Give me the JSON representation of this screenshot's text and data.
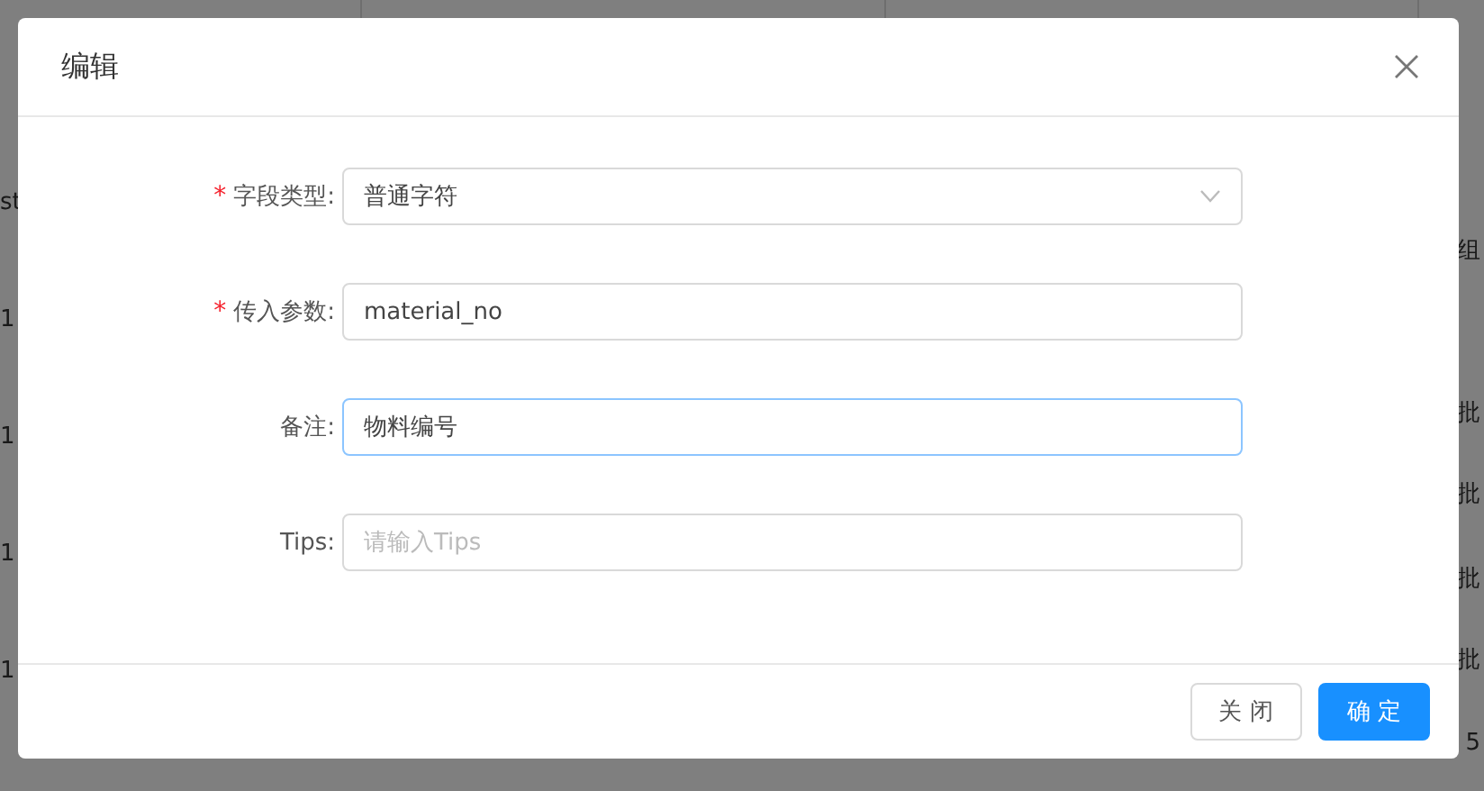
{
  "background_table": {
    "left_cells": [
      "st",
      "1",
      "1",
      "1",
      "1"
    ],
    "right_cells": [
      "组",
      "批",
      "批",
      "批",
      "批",
      "5"
    ]
  },
  "dialog": {
    "title": "编辑",
    "fields": [
      {
        "kind": "select",
        "label": "字段类型:",
        "required_mark": "*",
        "value": "普通字符",
        "focused": false
      },
      {
        "kind": "input",
        "label": "传入参数:",
        "required_mark": "*",
        "value": "material_no",
        "focused": false
      },
      {
        "kind": "input",
        "label": "备注:",
        "value": "物料编号",
        "focused": true
      },
      {
        "kind": "input",
        "label": "Tips:",
        "placeholder": "请输入Tips",
        "focused": false
      }
    ],
    "buttons": [
      {
        "label": "关 闭",
        "kind": "default"
      },
      {
        "label": "确 定",
        "kind": "primary"
      }
    ]
  }
}
